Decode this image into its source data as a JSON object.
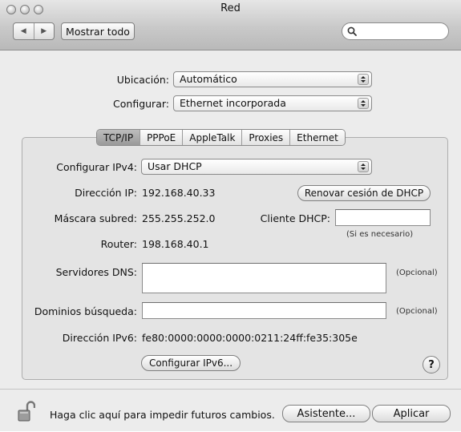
{
  "window": {
    "title": "Red"
  },
  "toolbar": {
    "back_glyph": "◀",
    "forward_glyph": "▶",
    "show_all_label": "Mostrar todo",
    "search_value": "",
    "search_placeholder": ""
  },
  "location": {
    "label": "Ubicación:",
    "value": "Automático"
  },
  "show": {
    "label": "Configurar:",
    "value": "Ethernet incorporada"
  },
  "tabs": [
    {
      "label": "TCP/IP",
      "active": true
    },
    {
      "label": "PPPoE",
      "active": false
    },
    {
      "label": "AppleTalk",
      "active": false
    },
    {
      "label": "Proxies",
      "active": false
    },
    {
      "label": "Ethernet",
      "active": false
    }
  ],
  "tcpip": {
    "configure_ipv4_label": "Configurar IPv4:",
    "configure_ipv4_value": "Usar DHCP",
    "ip_label": "Dirección IP:",
    "ip_value": "192.168.40.33",
    "renew_button": "Renovar cesión de DHCP",
    "subnet_label": "Máscara subred:",
    "subnet_value": "255.255.252.0",
    "dhcp_client_label": "Cliente DHCP:",
    "dhcp_client_value": "",
    "if_required": "(Si es necesario)",
    "router_label": "Router:",
    "router_value": "198.168.40.1",
    "dns_label": "Servidores DNS:",
    "dns_value": "",
    "dns_optional": "(Opcional)",
    "search_domains_label": "Dominios búsqueda:",
    "search_domains_value": "",
    "search_domains_optional": "(Opcional)",
    "ipv6_label": "Dirección IPv6:",
    "ipv6_value": "fe80:0000:0000:0000:0211:24ff:fe35:305e",
    "configure_ipv6_button": "Configurar IPv6...",
    "help_glyph": "?"
  },
  "footer": {
    "lock_text": "Haga clic aquí para impedir futuros cambios.",
    "assistant_button": "Asistente...",
    "apply_button": "Aplicar"
  }
}
